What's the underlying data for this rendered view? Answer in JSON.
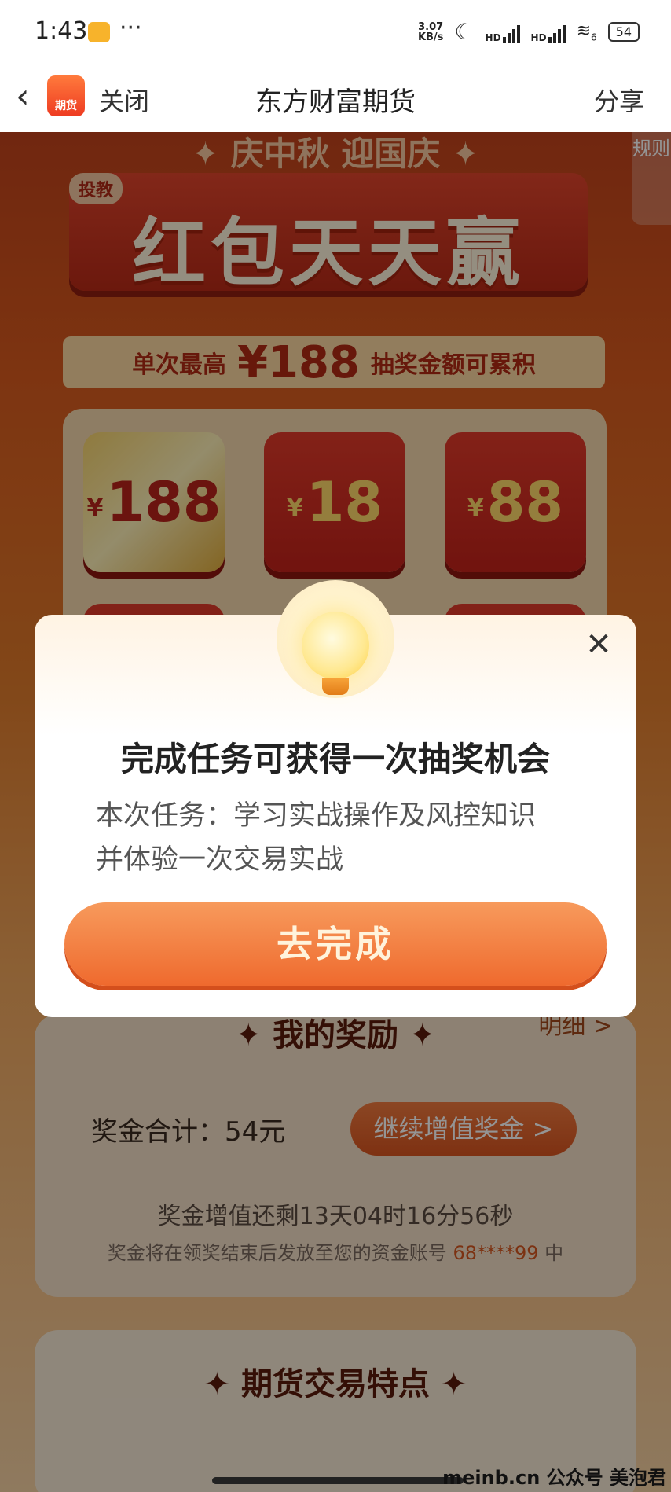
{
  "status_bar": {
    "time": "1:43",
    "dots": "···",
    "speed_value": "3.07",
    "speed_unit": "KB/s",
    "hd1": "HD",
    "hd2": "HD",
    "wifi_num": "6",
    "battery": "54"
  },
  "nav": {
    "logo_text": "期货",
    "close_label": "关闭",
    "title": "东方财富期货",
    "share_label": "分享"
  },
  "promo": {
    "festive_line": "✦ 庆中秋 迎国庆 ✦",
    "rules_label": "规则",
    "tag": "投教",
    "headline": "红包天天赢",
    "prize_prefix": "单次最高",
    "prize_amount": "¥188",
    "prize_suffix": "抽奖金额可累积",
    "cards": [
      {
        "currency": "¥",
        "value": "188"
      },
      {
        "currency": "¥",
        "value": "18"
      },
      {
        "currency": "¥",
        "value": "88"
      }
    ]
  },
  "rewards": {
    "title": "✦ 我的奖励 ✦",
    "detail_label": "明细 >",
    "total_text": "奖金合计：54元",
    "increase_button": "继续增值奖金 >",
    "countdown": "奖金增值还剩13天04时16分56秒",
    "notice_prefix": "奖金将在领奖结束后发放至您的资金账号",
    "account": "68****99",
    "notice_suffix": "中"
  },
  "features": {
    "title": "✦ 期货交易特点 ✦"
  },
  "modal": {
    "title": "完成任务可获得一次抽奖机会",
    "description_line1": "本次任务：学习实战操作及风控知识",
    "description_line2": "并体验一次交易实战",
    "button": "去完成",
    "close_glyph": "✕"
  },
  "watermark": "meinb.cn 公众号 美泡君",
  "colors": {
    "accent": "#ef6a2e",
    "festival_red": "#c3221a",
    "gold": "#ffd96a"
  }
}
